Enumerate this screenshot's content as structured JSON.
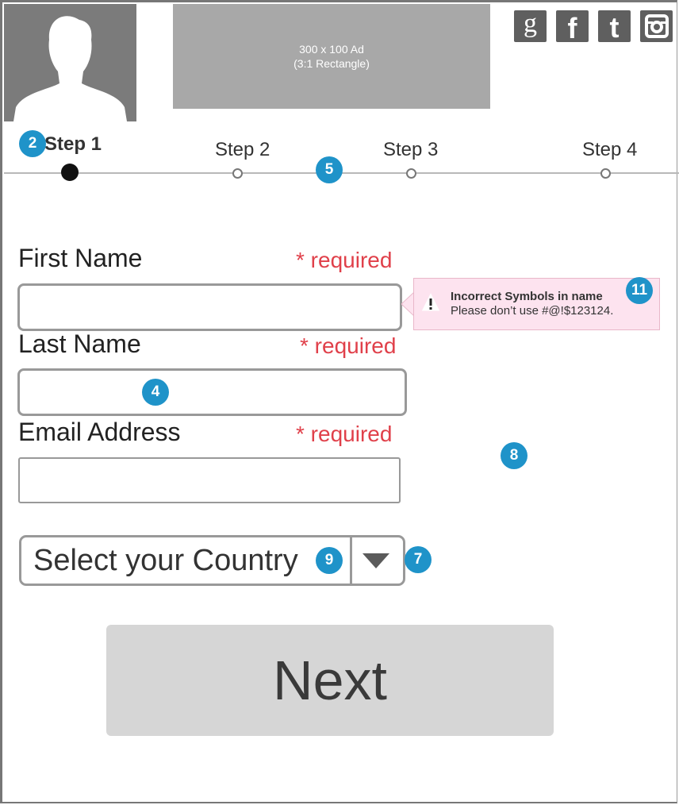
{
  "ad": {
    "line1": "300 x 100 Ad",
    "line2": "(3:1 Rectangle)"
  },
  "social": [
    {
      "icon": "google-icon",
      "glyph": "g"
    },
    {
      "icon": "facebook-icon",
      "glyph": "f"
    },
    {
      "icon": "twitter-icon",
      "glyph": "t"
    },
    {
      "icon": "instagram-icon",
      "glyph": ""
    }
  ],
  "steps": [
    {
      "label": "Step 1",
      "active": true
    },
    {
      "label": "Step 2",
      "active": false
    },
    {
      "label": "Step 3",
      "active": false
    },
    {
      "label": "Step 4",
      "active": false
    }
  ],
  "form": {
    "first_name": {
      "label": "First Name",
      "required": "* required",
      "value": ""
    },
    "last_name": {
      "label": "Last Name",
      "required": "* required",
      "value": ""
    },
    "email": {
      "label": "Email Address",
      "required": "* required",
      "value": ""
    },
    "country": {
      "value": "Select your Country"
    }
  },
  "tooltip": {
    "icon": "warning-icon",
    "title": "Incorrect Symbols in name",
    "message": "Please don’t use #@!$123124."
  },
  "next_button": "Next",
  "annotations": [
    "2",
    "5",
    "11",
    "4",
    "8",
    "9",
    "7"
  ],
  "colors": {
    "accent": "#1f93c9",
    "required": "#e0404a",
    "tooltip_bg": "#fde3ef",
    "button_bg": "#d6d6d6"
  }
}
